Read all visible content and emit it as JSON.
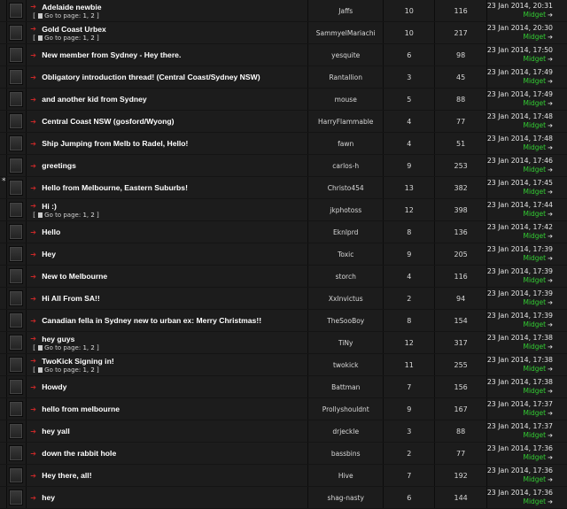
{
  "topics": [
    {
      "title": "Adelaide newbie",
      "author": "Jaffs",
      "replies": "10",
      "views": "116",
      "last_date": "23 Jan 2014, 20:31",
      "last_user": "Midget",
      "pages": [
        "1",
        "2"
      ],
      "dot": false
    },
    {
      "title": "Gold Coast Urbex",
      "author": "SammyelMariachi",
      "replies": "10",
      "views": "217",
      "last_date": "23 Jan 2014, 20:30",
      "last_user": "Midget",
      "pages": [
        "1",
        "2"
      ],
      "dot": false
    },
    {
      "title": "New member from Sydney - Hey there.",
      "author": "yesquite",
      "replies": "6",
      "views": "98",
      "last_date": "23 Jan 2014, 17:50",
      "last_user": "Midget",
      "pages": [],
      "dot": false
    },
    {
      "title": "Obligatory introduction thread! (Central Coast/Sydney NSW)",
      "author": "Rantallion",
      "replies": "3",
      "views": "45",
      "last_date": "23 Jan 2014, 17:49",
      "last_user": "Midget",
      "pages": [],
      "dot": false
    },
    {
      "title": "and another kid from Sydney",
      "author": "mouse",
      "replies": "5",
      "views": "88",
      "last_date": "23 Jan 2014, 17:49",
      "last_user": "Midget",
      "pages": [],
      "dot": false
    },
    {
      "title": "Central Coast NSW (gosford/Wyong)",
      "author": "HarryFlammable",
      "replies": "4",
      "views": "77",
      "last_date": "23 Jan 2014, 17:48",
      "last_user": "Midget",
      "pages": [],
      "dot": false
    },
    {
      "title": "Ship Jumping from Melb to Radel, Hello!",
      "author": "fawn",
      "replies": "4",
      "views": "51",
      "last_date": "23 Jan 2014, 17:48",
      "last_user": "Midget",
      "pages": [],
      "dot": false
    },
    {
      "title": "greetings",
      "author": "carlos-h",
      "replies": "9",
      "views": "253",
      "last_date": "23 Jan 2014, 17:46",
      "last_user": "Midget",
      "pages": [],
      "dot": false
    },
    {
      "title": "Hello from Melbourne, Eastern Suburbs!",
      "author": "Christo454",
      "replies": "13",
      "views": "382",
      "last_date": "23 Jan 2014, 17:45",
      "last_user": "Midget",
      "pages": [],
      "dot": true
    },
    {
      "title": "Hi :)",
      "author": "jkphotoss",
      "replies": "12",
      "views": "398",
      "last_date": "23 Jan 2014, 17:44",
      "last_user": "Midget",
      "pages": [
        "1",
        "2"
      ],
      "dot": false
    },
    {
      "title": "Hello",
      "author": "Eknlprd",
      "replies": "8",
      "views": "136",
      "last_date": "23 Jan 2014, 17:42",
      "last_user": "Midget",
      "pages": [],
      "dot": false
    },
    {
      "title": "Hey",
      "author": "Toxic",
      "replies": "9",
      "views": "205",
      "last_date": "23 Jan 2014, 17:39",
      "last_user": "Midget",
      "pages": [],
      "dot": false
    },
    {
      "title": "New to Melbourne",
      "author": "storch",
      "replies": "4",
      "views": "116",
      "last_date": "23 Jan 2014, 17:39",
      "last_user": "Midget",
      "pages": [],
      "dot": false
    },
    {
      "title": "Hi All From SA!!",
      "author": "XxInvictus",
      "replies": "2",
      "views": "94",
      "last_date": "23 Jan 2014, 17:39",
      "last_user": "Midget",
      "pages": [],
      "dot": false
    },
    {
      "title": "Canadian fella in Sydney new to urban ex: Merry Christmas!!",
      "author": "TheSooBoy",
      "replies": "8",
      "views": "154",
      "last_date": "23 Jan 2014, 17:39",
      "last_user": "Midget",
      "pages": [],
      "dot": false
    },
    {
      "title": "hey guys",
      "author": "TiNy",
      "replies": "12",
      "views": "317",
      "last_date": "23 Jan 2014, 17:38",
      "last_user": "Midget",
      "pages": [
        "1",
        "2"
      ],
      "dot": false
    },
    {
      "title": "TwoKick Signing in!",
      "author": "twokick",
      "replies": "11",
      "views": "255",
      "last_date": "23 Jan 2014, 17:38",
      "last_user": "Midget",
      "pages": [
        "1",
        "2"
      ],
      "dot": false
    },
    {
      "title": "Howdy",
      "author": "Battman",
      "replies": "7",
      "views": "156",
      "last_date": "23 Jan 2014, 17:38",
      "last_user": "Midget",
      "pages": [],
      "dot": false
    },
    {
      "title": "hello from melbourne",
      "author": "Prollyshouldnt",
      "replies": "9",
      "views": "167",
      "last_date": "23 Jan 2014, 17:37",
      "last_user": "Midget",
      "pages": [],
      "dot": false
    },
    {
      "title": "hey yall",
      "author": "drjeckle",
      "replies": "3",
      "views": "88",
      "last_date": "23 Jan 2014, 17:37",
      "last_user": "Midget",
      "pages": [],
      "dot": false
    },
    {
      "title": "down the rabbit hole",
      "author": "bassbins",
      "replies": "2",
      "views": "77",
      "last_date": "23 Jan 2014, 17:36",
      "last_user": "Midget",
      "pages": [],
      "dot": false
    },
    {
      "title": "Hey there, all!",
      "author": "Hive",
      "replies": "7",
      "views": "192",
      "last_date": "23 Jan 2014, 17:36",
      "last_user": "Midget",
      "pages": [],
      "dot": false
    },
    {
      "title": "hey",
      "author": "shag-nasty",
      "replies": "6",
      "views": "144",
      "last_date": "23 Jan 2014, 17:36",
      "last_user": "Midget",
      "pages": [],
      "dot": false
    }
  ],
  "labels": {
    "goto_pages": "Go to page:",
    "dot_marker": "*",
    "arrow_glyph": "➔",
    "goto_last_glyph": "➔"
  },
  "colors": {
    "title": "#ffffff",
    "last_user": "#33cc33",
    "arrow": "#c62828"
  }
}
